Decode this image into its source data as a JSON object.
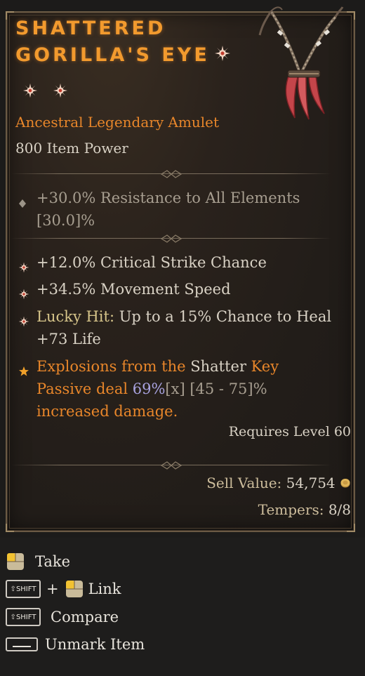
{
  "item": {
    "name_line1": "SHATTERED",
    "name_line2": "GORILLA'S EYE",
    "type": "Ancestral Legendary Amulet",
    "power": "800 Item Power",
    "implicit": {
      "value": "+30.0% Resistance to All Elements",
      "range": "[30.0]%"
    },
    "affixes": [
      {
        "text": "+12.0% Critical Strike Chance"
      },
      {
        "text": "+34.5% Movement Speed"
      },
      {
        "label": "Lucky Hit:",
        "text": " Up to a 15% Chance to Heal +73 Life"
      }
    ],
    "aspect": {
      "part1": "Explosions from the ",
      "part2": "Shatter",
      "part3": " Key Passive deal ",
      "value": "69%",
      "mult": "[x]",
      "range": " [45 - 75]%",
      "part4": " increased damage."
    },
    "requires": "Requires Level 60",
    "sell_label": "Sell Value:",
    "sell_value": "54,754",
    "tempers_label": "Tempers:",
    "tempers_value": "8/8"
  },
  "actions": {
    "take": "Take",
    "shift_key": "SHIFT",
    "plus": "+",
    "link": "Link",
    "compare": "Compare",
    "unmark": "Unmark Item"
  },
  "colors": {
    "legendary_orange": "#e8862a",
    "title_orange": "#f29a2e",
    "value_lavender": "#a9a3e0",
    "text_light": "#d9d2c5"
  },
  "icons": [
    "greater-affix-icon",
    "resistance-diamond-icon",
    "aspect-star-icon",
    "gold-coin-icon",
    "mouse-left-icon",
    "shift-key-icon",
    "space-key-icon"
  ]
}
